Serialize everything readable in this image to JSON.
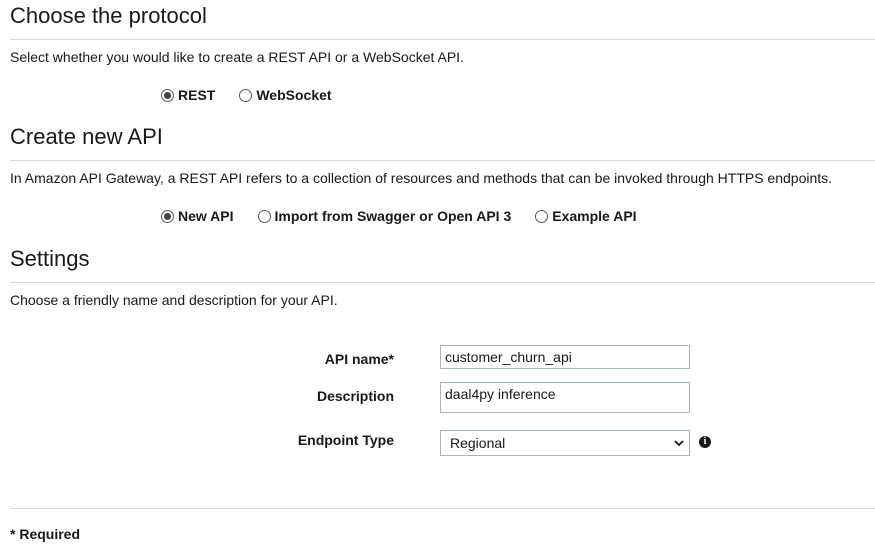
{
  "protocol": {
    "title": "Choose the protocol",
    "description": "Select whether you would like to create a REST API or a WebSocket API.",
    "options": [
      {
        "label": "REST",
        "checked": true
      },
      {
        "label": "WebSocket",
        "checked": false
      }
    ]
  },
  "create_api": {
    "title": "Create new API",
    "description": "In Amazon API Gateway, a REST API refers to a collection of resources and methods that can be invoked through HTTPS endpoints.",
    "options": [
      {
        "label": "New API",
        "checked": true
      },
      {
        "label": "Import from Swagger or Open API 3",
        "checked": false
      },
      {
        "label": "Example API",
        "checked": false
      }
    ]
  },
  "settings": {
    "title": "Settings",
    "description": "Choose a friendly name and description for your API.",
    "api_name_label": "API name*",
    "api_name_value": "customer_churn_api",
    "description_label": "Description",
    "description_value": "daal4py inference",
    "endpoint_type_label": "Endpoint Type",
    "endpoint_type_value": "Regional",
    "info_icon": "info-icon"
  },
  "footer": {
    "required_note": "* Required"
  },
  "colors": {
    "text": "#16191f",
    "divider": "#d5dbdb",
    "input_border": "#aab7b8"
  }
}
